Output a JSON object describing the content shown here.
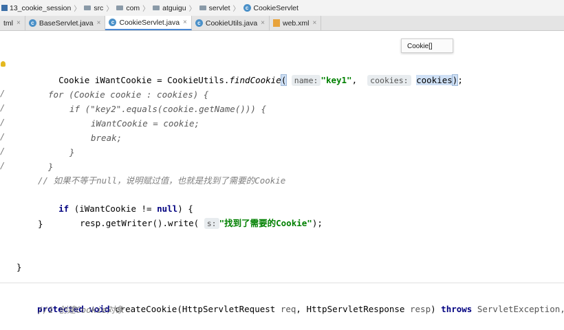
{
  "breadcrumbs": [
    {
      "label": "13_cookie_session",
      "icon": "module-icon"
    },
    {
      "label": "src",
      "icon": "folder-icon"
    },
    {
      "label": "com",
      "icon": "folder-icon"
    },
    {
      "label": "atguigu",
      "icon": "folder-icon"
    },
    {
      "label": "servlet",
      "icon": "folder-icon"
    },
    {
      "label": "CookieServlet",
      "icon": "class-icon"
    }
  ],
  "tabs": [
    {
      "label": "tml",
      "close": "×"
    },
    {
      "label": "BaseServlet.java",
      "close": "×"
    },
    {
      "label": "CookieServlet.java",
      "close": "×",
      "active": true
    },
    {
      "label": "CookieUtils.java",
      "close": "×"
    },
    {
      "label": "web.xml",
      "close": "×"
    }
  ],
  "tooltip": "Cookie[]",
  "code": {
    "l1_a": "Cookie iWantCookie = CookieUtils.",
    "l1_fn": "findCookie",
    "l1_paren": "(",
    "l1_hint1": "name:",
    "l1_str": "\"key1\"",
    "l1_comma": ",",
    "l1_hint2": "cookies:",
    "l1_arg": "cookies",
    "l1_close": ")",
    "l1_end": ";",
    "c1": "for (Cookie cookie : cookies) {",
    "c2": "if (\"key2\".equals(cookie.getName())) {",
    "c3": "iWantCookie = cookie;",
    "c4": "break;",
    "c5": "}",
    "c6": "}",
    "comment": "// 如果不等于null，说明赋过值，也就是找到了需要的Cookie",
    "if_kw": "if",
    "if_mid": " (iWantCookie != ",
    "if_null": "null",
    "if_end": ") {",
    "w_a": "resp.getWriter().write(",
    "w_hint": "s:",
    "w_str": "\"找到了需要的Cookie\"",
    "w_end": ");",
    "close1": "}",
    "close2": "}",
    "p_kw1": "protected",
    "p_kw2": "void",
    "p_name": "createCookie(HttpServletRequest ",
    "p_req": "req",
    "p_mid": ", HttpServletResponse ",
    "p_resp": "resp",
    "p_close": ") ",
    "p_throws": "throws",
    "p_exc": " ServletException,",
    "p_cmt": "//1 创建Cookie对象"
  },
  "gutter_marks": [
    "/",
    "/",
    "/",
    "/",
    "/",
    "/"
  ]
}
